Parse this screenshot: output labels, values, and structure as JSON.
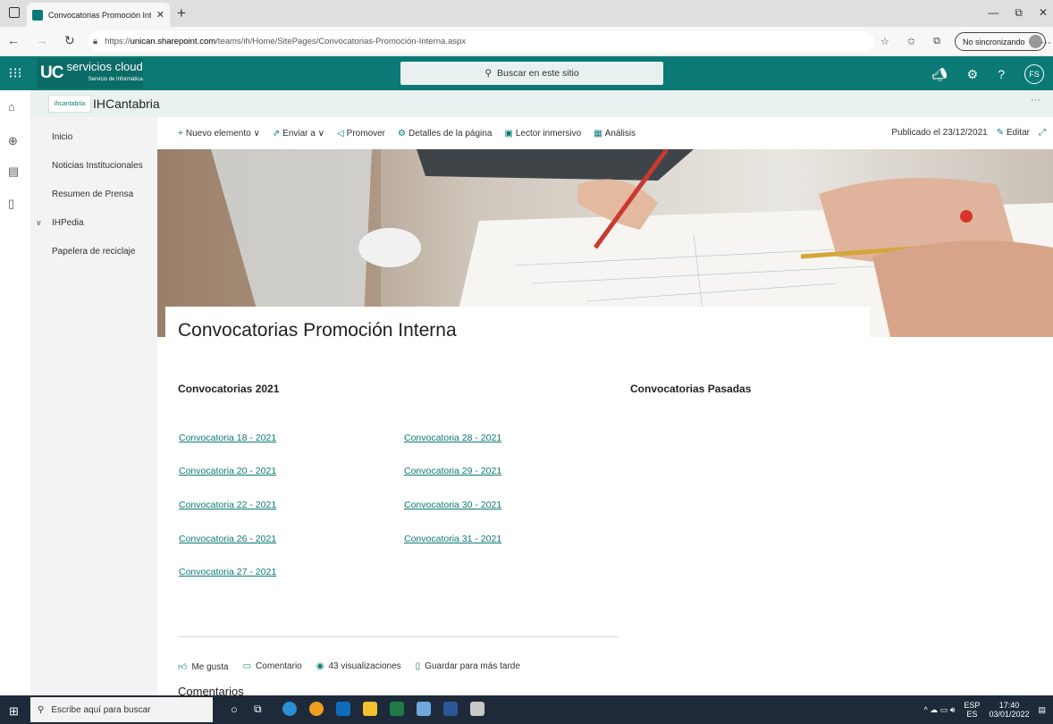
{
  "browser": {
    "tab_title": "Convocatorias Promoción Intern",
    "url_prefix": "https://",
    "url_host": "unican.sharepoint.com",
    "url_path": "/teams/ih/Home/SitePages/Convocatorias-Promoción-Interna.aspx",
    "sync_label": "No sincronizando"
  },
  "suite": {
    "logo_uc": "UC",
    "logo_title": "servicios cloud",
    "logo_sub": "Servicio de Informática",
    "search_placeholder": "Buscar en este sitio",
    "user_initials": "FS"
  },
  "site": {
    "logo_text": "ihcantabria",
    "name": "IHCantabria",
    "more": "···"
  },
  "nav": {
    "items": [
      "Inicio",
      "Noticias Institucionales",
      "Resumen de Prensa",
      "IHPedia",
      "Papelera de reciclaje"
    ]
  },
  "commands": {
    "new_item": "Nuevo elemento",
    "send_to": "Enviar a",
    "promote": "Promover",
    "page_details": "Detalles de la página",
    "immersive_reader": "Lector inmersivo",
    "analytics": "Análisis",
    "published": "Publicado el 23/12/2021",
    "edit": "Editar"
  },
  "page": {
    "title": "Convocatorias Promoción Interna",
    "section_2021": "Convocatorias 2021",
    "section_past": "Convocatorias Pasadas",
    "links_col1": [
      "Convocatoria 18 - 2021",
      "Convocatoria 20 - 2021",
      "Convocatoria 22 - 2021",
      "Convocatoria 26 - 2021",
      "Convocatoria 27 - 2021"
    ],
    "links_col2": [
      "Convocatoria 28 - 2021",
      "Convocatoria 29 - 2021",
      "Convocatoria 30 - 2021",
      "Convocatoria 31 - 2021"
    ]
  },
  "social": {
    "like": "Me gusta",
    "comment": "Comentario",
    "views": "43 visualizaciones",
    "save": "Guardar para más tarde",
    "comments_heading": "Comentarios"
  },
  "taskbar": {
    "search_placeholder": "Escribe aquí para buscar",
    "lang": "ESP",
    "lang_sub": "ES",
    "time": "17:40",
    "date": "03/01/2022"
  },
  "colors": {
    "accent": "#0b7a75",
    "suite": "#0b7a75"
  }
}
